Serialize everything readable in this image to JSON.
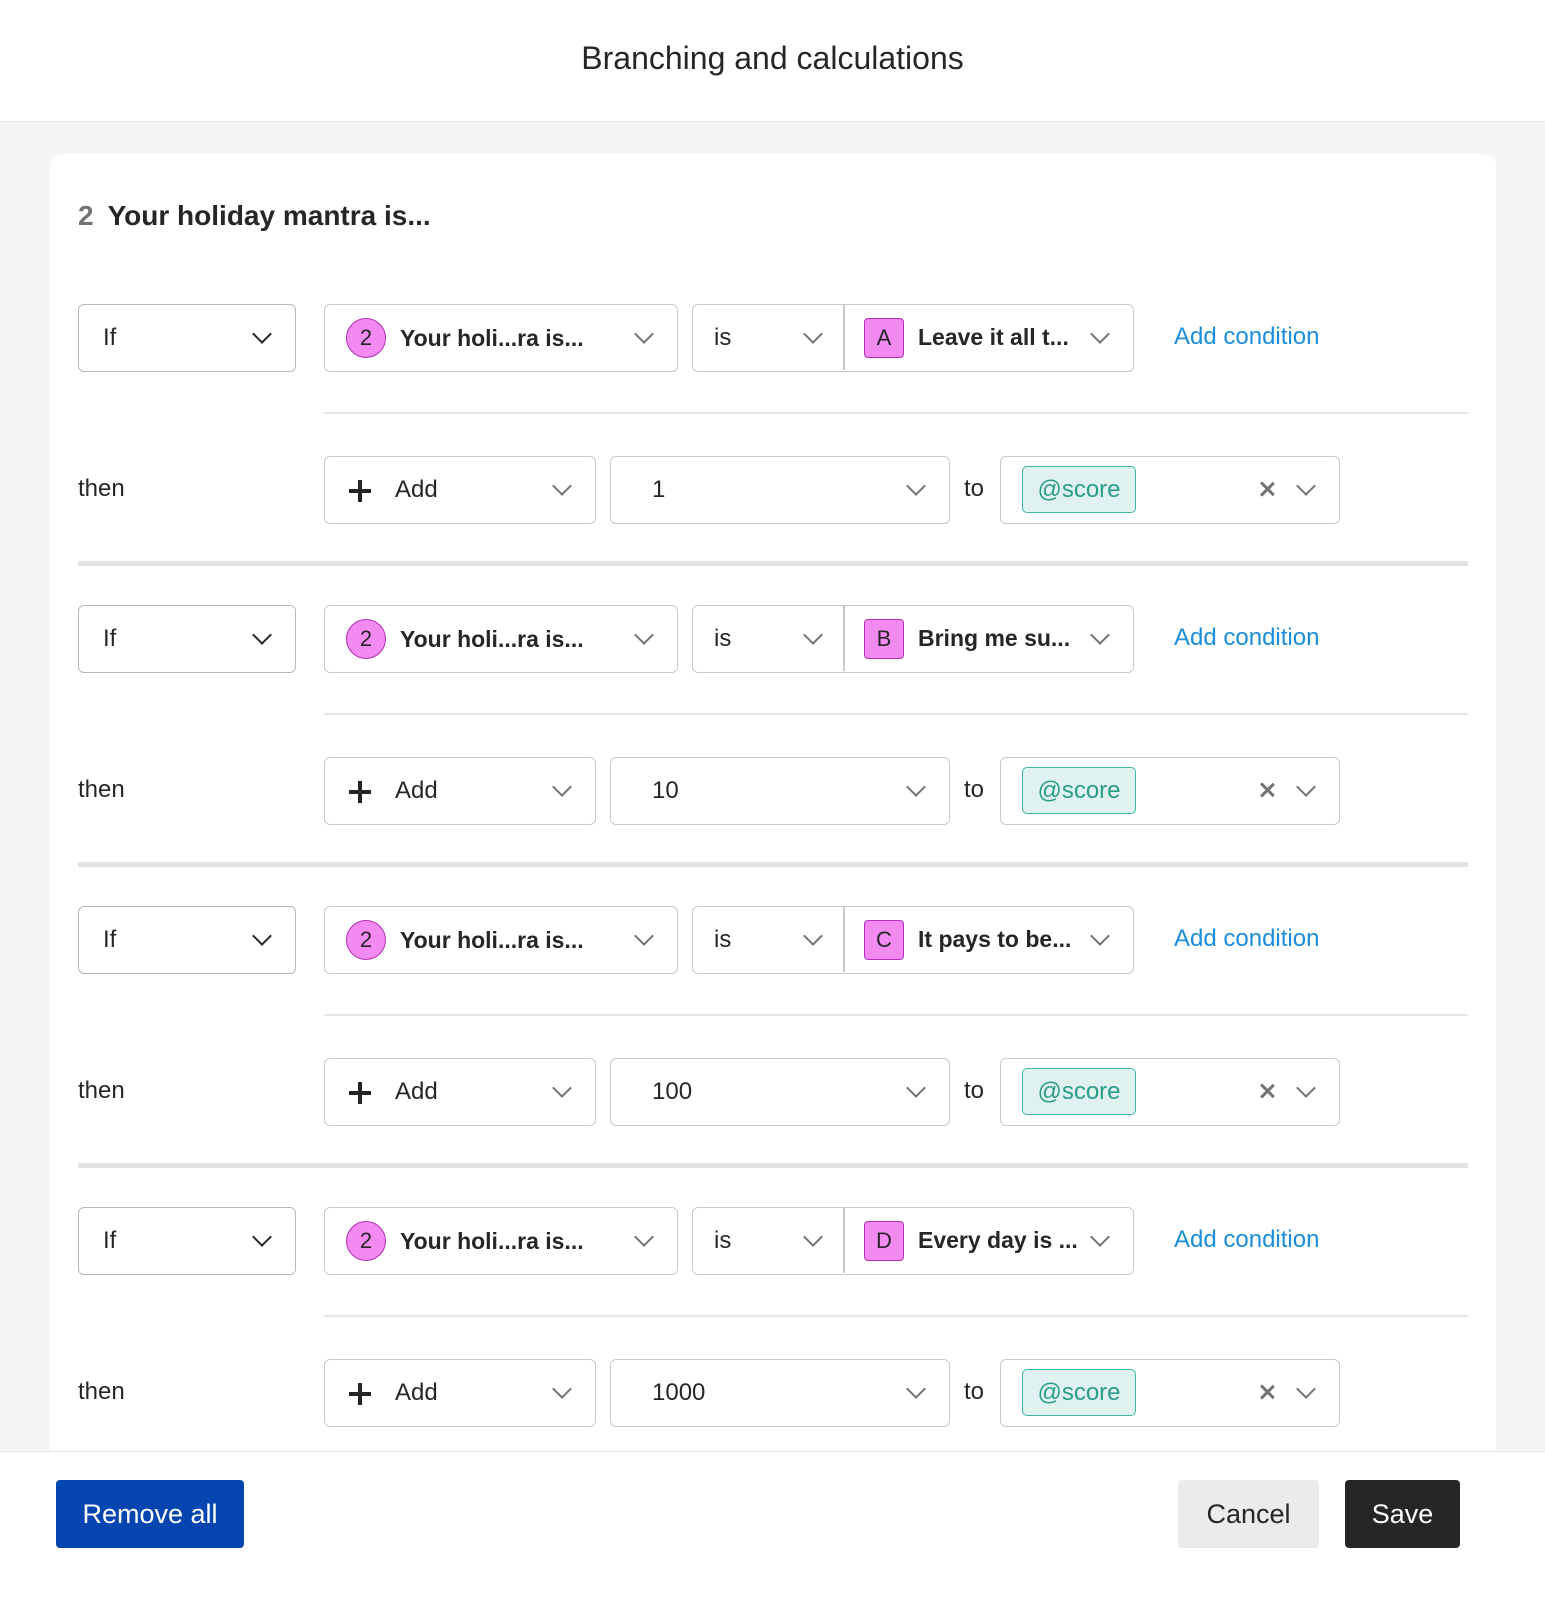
{
  "header": {
    "title": "Branching and calculations"
  },
  "question": {
    "number": "2",
    "title": "Your holiday mantra is..."
  },
  "rules": [
    {
      "if_label": "If",
      "question_badge": "2",
      "question_text": "Your holi...ra is...",
      "operator": "is",
      "choice_letter": "A",
      "choice_text": "Leave it all t...",
      "add_condition": "Add condition",
      "then_label": "then",
      "action": "Add",
      "value": "1",
      "to_label": "to",
      "variable": "@score"
    },
    {
      "if_label": "If",
      "question_badge": "2",
      "question_text": "Your holi...ra is...",
      "operator": "is",
      "choice_letter": "B",
      "choice_text": "Bring me su...",
      "add_condition": "Add condition",
      "then_label": "then",
      "action": "Add",
      "value": "10",
      "to_label": "to",
      "variable": "@score"
    },
    {
      "if_label": "If",
      "question_badge": "2",
      "question_text": "Your holi...ra is...",
      "operator": "is",
      "choice_letter": "C",
      "choice_text": "It pays to be...",
      "add_condition": "Add condition",
      "then_label": "then",
      "action": "Add",
      "value": "100",
      "to_label": "to",
      "variable": "@score"
    },
    {
      "if_label": "If",
      "question_badge": "2",
      "question_text": "Your holi...ra is...",
      "operator": "is",
      "choice_letter": "D",
      "choice_text": "Every day is ...",
      "add_condition": "Add condition",
      "then_label": "then",
      "action": "Add",
      "value": "1000",
      "to_label": "to",
      "variable": "@score"
    }
  ],
  "footer": {
    "remove_all": "Remove all",
    "cancel": "Cancel",
    "save": "Save"
  },
  "colors": {
    "accent_link": "#1a8ddb",
    "badge_pink": "#f28af2",
    "variable_teal": "#3cb8a5",
    "primary_blue": "#0445af",
    "dark_button": "#262627"
  }
}
